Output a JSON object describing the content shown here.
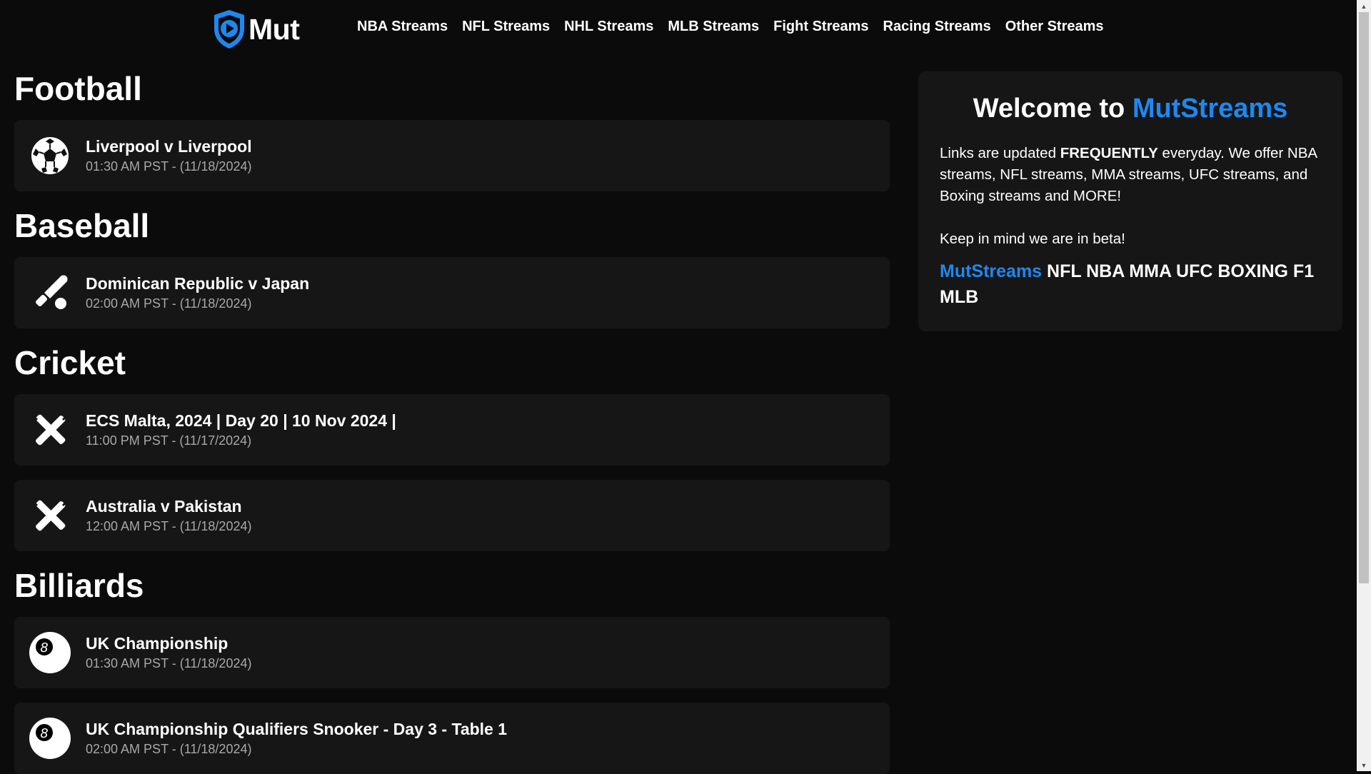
{
  "header": {
    "logo_text": "Mut",
    "nav": [
      {
        "label": "NBA Streams"
      },
      {
        "label": "NFL Streams"
      },
      {
        "label": "NHL Streams"
      },
      {
        "label": "MLB Streams"
      },
      {
        "label": "Fight Streams"
      },
      {
        "label": "Racing Streams"
      },
      {
        "label": "Other Streams"
      }
    ]
  },
  "sections": [
    {
      "title": "Football",
      "events": [
        {
          "icon": "soccer-ball-icon",
          "name": "Liverpool v Liverpool",
          "time": "01:30 AM PST - (11/18/2024)"
        }
      ]
    },
    {
      "title": "Baseball",
      "events": [
        {
          "icon": "baseball-bat-icon",
          "name": "Dominican Republic v Japan",
          "time": "02:00 AM PST - (11/18/2024)"
        }
      ]
    },
    {
      "title": "Cricket",
      "events": [
        {
          "icon": "cricket-bats-icon",
          "name": "ECS Malta, 2024 | Day 20 | 10 Nov 2024 |",
          "time": "11:00 PM PST - (11/17/2024)"
        },
        {
          "icon": "cricket-bats-icon",
          "name": "Australia v Pakistan",
          "time": "12:00 AM PST - (11/18/2024)"
        }
      ]
    },
    {
      "title": "Billiards",
      "events": [
        {
          "icon": "eight-ball-icon",
          "name": "UK Championship",
          "time": "01:30 AM PST - (11/18/2024)"
        },
        {
          "icon": "eight-ball-icon",
          "name": "UK Championship Qualifiers Snooker - Day 3 - Table 1",
          "time": "02:00 AM PST - (11/18/2024)"
        }
      ]
    }
  ],
  "sidebar": {
    "welcome_prefix": "Welcome to ",
    "welcome_brand": "MutStreams",
    "desc_prefix": "Links are updated ",
    "desc_bold": "FREQUENTLY",
    "desc_suffix": " everyday. We offer NBA streams, NFL streams, MMA streams, UFC streams, and Boxing streams and MORE!",
    "beta": "Keep in mind we are in beta!",
    "tags_brand": "MutStreams",
    "tags_rest": " NFL NBA MMA UFC BOXING F1 MLB"
  },
  "colors": {
    "accent": "#1e88f0",
    "background": "#0b0b0b",
    "card": "#161616",
    "muted": "#a8a8a8"
  }
}
